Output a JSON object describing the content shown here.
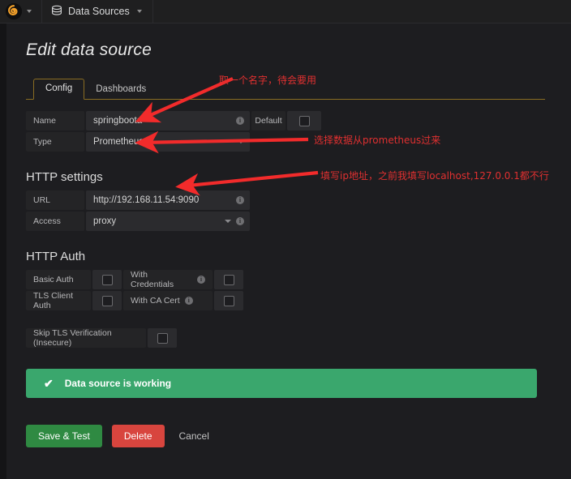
{
  "navbar": {
    "logo_icon": "grafana-logo-icon",
    "logo_caret_icon": "chevron-down-icon",
    "data_sources_icon": "database-icon",
    "data_sources_label": "Data Sources",
    "data_sources_caret_icon": "chevron-down-icon"
  },
  "page": {
    "title": "Edit data source"
  },
  "tabs": [
    {
      "label": "Config",
      "active": true
    },
    {
      "label": "Dashboards",
      "active": false
    }
  ],
  "settings": {
    "name_label": "Name",
    "name_value": "springboota",
    "name_info_icon": "info-icon",
    "default_label": "Default",
    "default_checked": false,
    "type_label": "Type",
    "type_value": "Prometheus",
    "type_caret_icon": "chevron-down-icon"
  },
  "http_settings": {
    "section_title": "HTTP settings",
    "url_label": "URL",
    "url_value": "http://192.168.11.54:9090",
    "url_info_icon": "info-icon",
    "access_label": "Access",
    "access_value": "proxy",
    "access_caret_icon": "chevron-down-icon",
    "access_info_icon": "info-icon"
  },
  "http_auth": {
    "section_title": "HTTP Auth",
    "basic_auth_label": "Basic Auth",
    "basic_auth_checked": false,
    "with_credentials_label": "With Credentials",
    "with_credentials_info_icon": "info-icon",
    "with_credentials_checked": false,
    "tls_client_auth_label": "TLS Client Auth",
    "tls_client_auth_checked": false,
    "with_ca_cert_label": "With CA Cert",
    "with_ca_cert_info_icon": "info-icon",
    "with_ca_cert_checked": false,
    "skip_tls_label": "Skip TLS Verification (Insecure)",
    "skip_tls_checked": false
  },
  "alert": {
    "icon": "check-icon",
    "message": "Data source is working",
    "color": "#3aa76d"
  },
  "buttons": {
    "save_label": "Save & Test",
    "delete_label": "Delete",
    "cancel_label": "Cancel",
    "save_color": "#2f8a42",
    "delete_color": "#d8453e"
  },
  "annotations": {
    "color": "#e03030",
    "name_note": "取一个名字，待会要用",
    "type_note": "选择数据从prometheus过来",
    "url_note": "填写ip地址，之前我填写localhost,127.0.0.1都不行"
  }
}
